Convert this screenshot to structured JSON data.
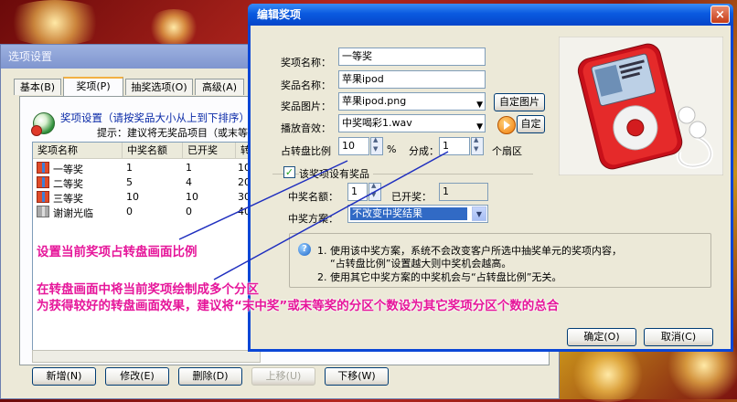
{
  "background_window": {
    "title": "选项设置",
    "tabs": [
      "基本(B)",
      "奖项(P)",
      "抽奖选项(O)",
      "高级(A)"
    ],
    "header_title": "奖项设置（请按奖品大小从上到下排序）",
    "header_hint": "提示：建议将无奖品项目（或末等奖）",
    "columns": [
      "奖项名称",
      "中奖名额",
      "已开奖",
      "转"
    ],
    "rows": [
      {
        "name": "一等奖",
        "quota": "1",
        "opened": "1",
        "ratio": "10"
      },
      {
        "name": "二等奖",
        "quota": "5",
        "opened": "4",
        "ratio": "20"
      },
      {
        "name": "三等奖",
        "quota": "10",
        "opened": "10",
        "ratio": "30"
      },
      {
        "name": "谢谢光临",
        "quota": "0",
        "opened": "0",
        "ratio": "40"
      }
    ],
    "buttons": {
      "add": "新增(N)",
      "edit": "修改(E)",
      "delete": "删除(D)",
      "up": "上移(U)",
      "down": "下移(W)"
    }
  },
  "dialog": {
    "title": "编辑奖项",
    "close_glyph": "×",
    "fields": {
      "prize_name_label": "奖项名称：",
      "prize_name": "一等奖",
      "item_name_label": "奖品名称：",
      "item_name": "苹果ipod",
      "image_label": "奖品图片：",
      "image_value": "苹果ipod.png",
      "image_button": "自定图片",
      "sound_label": "播放音效：",
      "sound_value": "中奖喝彩1.wav",
      "sound_button": "自定",
      "ratio_label": "占转盘比例",
      "ratio_value": "10",
      "ratio_unit": "%",
      "sections_label": "分成：",
      "sections_value": "1",
      "sections_unit": "个扇区",
      "has_prize_label": "该奖项设有奖品",
      "quota_label": "中奖名额：",
      "quota_value": "1",
      "opened_label": "已开奖：",
      "opened_value": "1",
      "plan_label": "中奖方案：",
      "plan_value": "不改变中奖结果"
    },
    "info_lines": [
      "1. 使用该中奖方案，系统不会改变客户所选中抽奖单元的奖项内容，",
      "“占转盘比例”设置越大则中奖机会越高。",
      "2. 使用其它中奖方案的中奖机会与“占转盘比例”无关。"
    ],
    "ok_button": "确定(O)",
    "cancel_button": "取消(C)"
  },
  "annotations": {
    "note1": "设置当前奖项占转盘画面比例",
    "note2": "在转盘画面中将当前奖项绘制成多个分区",
    "note3": "为获得较好的转盘画面效果，建议将“末中奖”或末等奖的分区个数设为其它奖项分区个数的总合"
  },
  "colors": {
    "annotation": "#e6169a",
    "titlebar": "#0a5ae0",
    "selection": "#316ac5"
  }
}
